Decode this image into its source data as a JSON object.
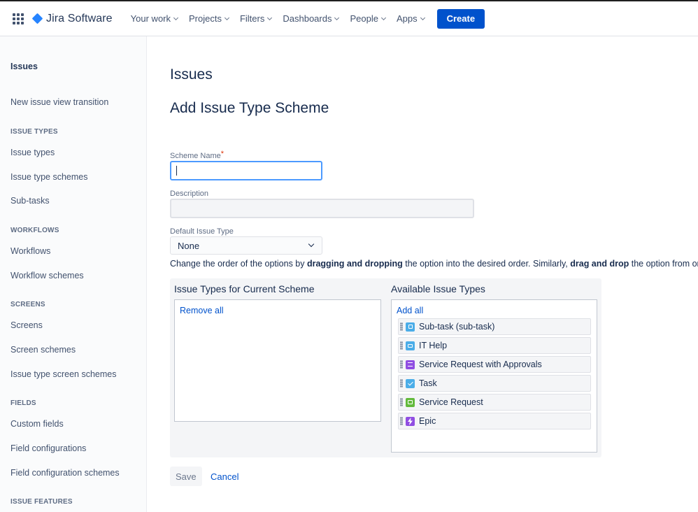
{
  "topnav": {
    "product_name": "Jira Software",
    "menus": [
      "Your work",
      "Projects",
      "Filters",
      "Dashboards",
      "People",
      "Apps"
    ],
    "create_label": "Create"
  },
  "sidebar": {
    "title": "Issues",
    "new_issue_view": "New issue view transition",
    "sections": [
      {
        "heading": "ISSUE TYPES",
        "items": [
          "Issue types",
          "Issue type schemes",
          "Sub-tasks"
        ]
      },
      {
        "heading": "WORKFLOWS",
        "items": [
          "Workflows",
          "Workflow schemes"
        ]
      },
      {
        "heading": "SCREENS",
        "items": [
          "Screens",
          "Screen schemes",
          "Issue type screen schemes"
        ]
      },
      {
        "heading": "FIELDS",
        "items": [
          "Custom fields",
          "Field configurations",
          "Field configuration schemes"
        ]
      },
      {
        "heading": "ISSUE FEATURES",
        "items": []
      }
    ]
  },
  "main": {
    "page_title": "Issues",
    "form_title": "Add Issue Type Scheme",
    "scheme_name_label": "Scheme Name",
    "required_marker": "*",
    "scheme_name_value": "",
    "description_label": "Description",
    "description_value": "",
    "default_type_label": "Default Issue Type",
    "default_type_value": "None",
    "help": {
      "t1": "Change the order of the options by ",
      "b1": "dragging and dropping",
      "t2": " the option into the desired order. Similarly, ",
      "b2": "drag and drop",
      "t3": " the option from one"
    },
    "current_title": "Issue Types for Current Scheme",
    "remove_all_label": "Remove all",
    "available_title": "Available Issue Types",
    "add_all_label": "Add all",
    "available_items": [
      {
        "label": "Sub-task (sub-task)",
        "icon": "subtask-icon",
        "color": "#4bade8"
      },
      {
        "label": "IT Help",
        "icon": "it-help-icon",
        "color": "#4bade8"
      },
      {
        "label": "Service Request with Approvals",
        "icon": "service-request-approvals-icon",
        "color": "#904ee2"
      },
      {
        "label": "Task",
        "icon": "task-icon",
        "color": "#4bade8"
      },
      {
        "label": "Service Request",
        "icon": "service-request-icon",
        "color": "#63ba3c"
      },
      {
        "label": "Epic",
        "icon": "epic-icon",
        "color": "#904ee2"
      }
    ],
    "save_label": "Save",
    "cancel_label": "Cancel"
  }
}
